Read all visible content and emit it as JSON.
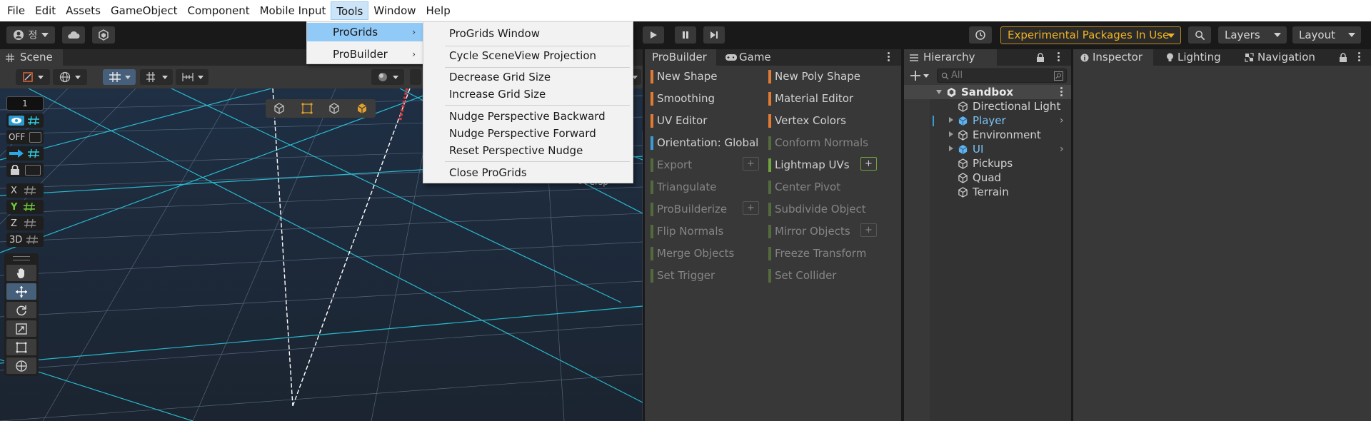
{
  "menubar": {
    "items": [
      "File",
      "Edit",
      "Assets",
      "GameObject",
      "Component",
      "Mobile Input",
      "Tools",
      "Window",
      "Help"
    ]
  },
  "toolbar": {
    "account_glyph": "정",
    "experimental_label": "Experimental Packages In Use",
    "layers_label": "Layers",
    "layout_label": "Layout"
  },
  "scene": {
    "tab_label": "Scene",
    "grid_value": "1",
    "off_label": "OFF",
    "axis_x": "X",
    "axis_y": "Y",
    "axis_z": "Z",
    "mode_3d": "3D",
    "persp_label": "< Persp",
    "accent": "#2ad3e8"
  },
  "tools_menu": {
    "items": [
      {
        "label": "ProGrids",
        "has_submenu": true,
        "highlighted": true
      },
      {
        "label": "ProBuilder",
        "has_submenu": true,
        "highlighted": false
      }
    ]
  },
  "progrids_menu": {
    "items": [
      "ProGrids Window",
      "Cycle SceneView Projection",
      "Decrease Grid Size",
      "Increase Grid Size",
      "Nudge Perspective Backward",
      "Nudge Perspective Forward",
      "Reset Perspective Nudge",
      "Close ProGrids"
    ]
  },
  "probuilder": {
    "tab_label": "ProBuilder",
    "game_tab_label": "Game",
    "left": [
      "New Shape",
      "Smoothing",
      "UV Editor",
      "Orientation: Global",
      "Export",
      "Triangulate",
      "ProBuilderize",
      "Flip Normals",
      "Merge Objects",
      "Set Trigger"
    ],
    "right": [
      "New Poly Shape",
      "Material Editor",
      "Vertex Colors",
      "Conform Normals",
      "Lightmap UVs",
      "Center Pivot",
      "Subdivide Object",
      "Mirror Objects",
      "Freeze Transform",
      "Set Collider"
    ],
    "plus": "+",
    "colors": {
      "orange": "#e07b34",
      "blue": "#3a9bd6",
      "green": "#6fa43c"
    }
  },
  "hierarchy": {
    "tab_label": "Hierarchy",
    "search_placeholder": "All",
    "root": "Sandbox",
    "items": [
      "Directional Light",
      "Player",
      "Environment",
      "UI",
      "Pickups",
      "Quad",
      "Terrain"
    ]
  },
  "inspector": {
    "tabs": [
      "Inspector",
      "Lighting",
      "Navigation"
    ]
  }
}
